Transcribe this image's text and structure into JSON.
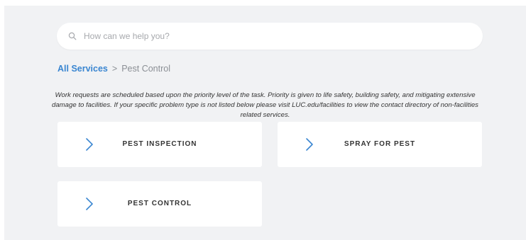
{
  "search": {
    "placeholder": "How can we help you?"
  },
  "breadcrumb": {
    "root": "All Services",
    "separator": ">",
    "current": "Pest Control"
  },
  "notice": {
    "line1": "Work requests are scheduled based upon the priority level of the task. Priority is given to life safety, building safety, and mitigating extensive",
    "line2": "damage to facilities. If your specific problem type is not listed below please visit LUC.edu/facilities to view the contact directory of non-facilities",
    "line3": "related services."
  },
  "services": [
    {
      "label": "PEST INSPECTION",
      "icon": "chevron-right-icon"
    },
    {
      "label": "SPRAY FOR PEST",
      "icon": "chevron-right-icon"
    },
    {
      "label": "PEST CONTROL",
      "icon": "chevron-right-icon"
    }
  ],
  "colors": {
    "background": "#f1f2f4",
    "accent": "#3a86d1",
    "card": "#ffffff"
  }
}
